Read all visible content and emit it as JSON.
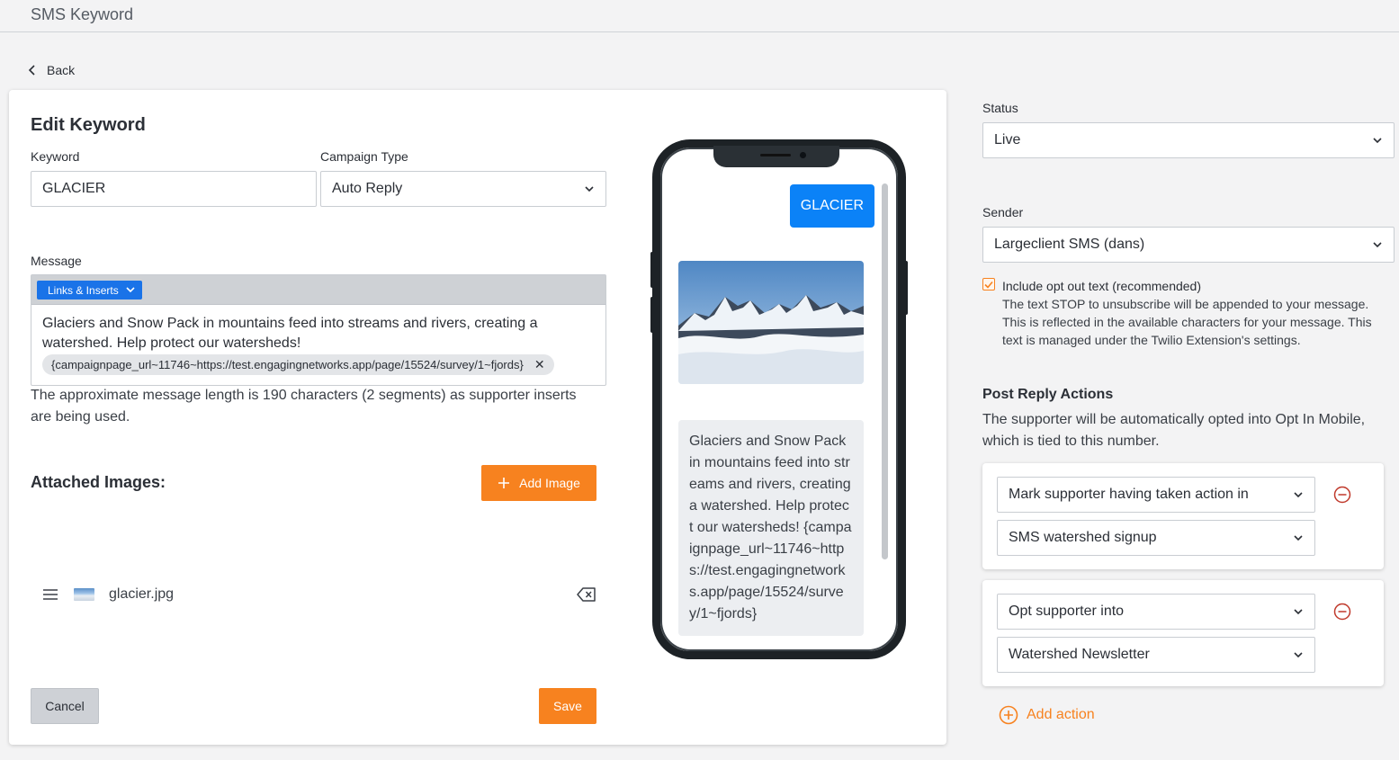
{
  "header": {
    "title": "SMS Keyword"
  },
  "nav": {
    "back_label": "Back"
  },
  "form": {
    "heading": "Edit Keyword",
    "keyword_label": "Keyword",
    "keyword_value": "GLACIER",
    "campaign_type_label": "Campaign Type",
    "campaign_type_value": "Auto Reply",
    "message_label": "Message",
    "links_inserts_label": "Links & Inserts",
    "message_text": "Glaciers and Snow Pack in mountains feed into streams and rivers, creating a watershed. Help protect our watersheds!",
    "insert_chip": "{campaignpage_url~11746~https://test.engagingnetworks.app/page/15524/survey/1~fjords}",
    "length_note": "The approximate message length is 190 characters (2 segments) as supporter inserts are being used.",
    "attached_images_heading": "Attached Images:",
    "add_image_label": "Add Image",
    "images": [
      {
        "filename": "glacier.jpg"
      }
    ],
    "cancel_label": "Cancel",
    "save_label": "Save"
  },
  "preview": {
    "outgoing": "GLACIER",
    "incoming": "Glaciers and Snow Pack in mountains feed into streams and rivers, creating a watershed. Help protect our watersheds! {campaignpage_url~11746~https://test.engagingnetworks.app/page/15524/survey/1~fjords}"
  },
  "settings": {
    "status_label": "Status",
    "status_value": "Live",
    "sender_label": "Sender",
    "sender_value": "Largeclient SMS (dans)",
    "optout_label": "Include opt out text (recommended)",
    "optout_checked": true,
    "optout_note": "The text STOP to unsubscribe will be appended to your message. This is reflected in the available characters for your message. This text is managed under the Twilio Extension's settings."
  },
  "post_reply": {
    "heading": "Post Reply Actions",
    "description": "The supporter will be automatically opted into Opt In Mobile, which is tied to this number.",
    "actions": [
      {
        "type": "Mark supporter having taken action in",
        "target": "SMS watershed signup"
      },
      {
        "type": "Opt supporter into",
        "target": "Watershed Newsletter"
      }
    ],
    "add_action_label": "Add action"
  },
  "colors": {
    "accent": "#f7821f",
    "primary_blue": "#0b82f7",
    "links_button": "#1a73e8"
  }
}
